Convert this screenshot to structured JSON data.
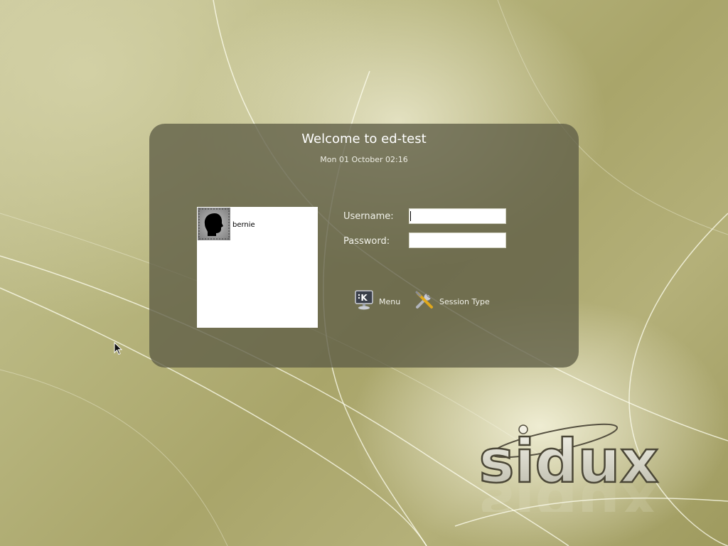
{
  "login": {
    "welcome": "Welcome to ed-test",
    "clock": "Mon 01 October 02:16",
    "username_label": "Username:",
    "password_label": "Password:",
    "username_value": "",
    "password_value": ""
  },
  "users": [
    {
      "name": "bernie",
      "icon": "user-face-silhouette-icon"
    }
  ],
  "actions": {
    "menu_label": "Menu",
    "menu_icon": "kde-monitor-icon",
    "session_label": "Session Type",
    "session_icon": "tools-icon"
  },
  "branding": {
    "logo_text": "sidux"
  },
  "colors": {
    "panel": "#5f5e46",
    "wallpaper": "#b8b67f",
    "text": "#ffffff"
  }
}
